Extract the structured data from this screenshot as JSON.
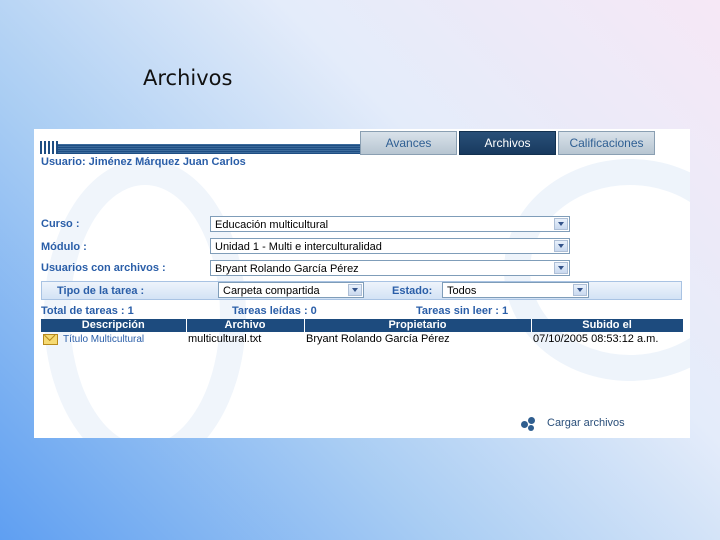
{
  "slide": {
    "title": "Archivos"
  },
  "tabs": [
    {
      "label": "Avances",
      "active": false
    },
    {
      "label": "Archivos",
      "active": true
    },
    {
      "label": "Calificaciones",
      "active": false
    }
  ],
  "user_line": "Usuario: Jiménez Márquez Juan Carlos",
  "filters": {
    "curso": {
      "label": "Curso :",
      "value": "Educación multicultural"
    },
    "modulo": {
      "label": "Módulo :",
      "value": "Unidad 1 - Multi e interculturalidad"
    },
    "usuarios": {
      "label": "Usuarios con archivos :",
      "value": "Bryant Rolando García Pérez"
    },
    "tipo": {
      "label": "Tipo de la tarea :",
      "value": "Carpeta compartida"
    },
    "estado": {
      "label": "Estado:",
      "value": "Todos"
    }
  },
  "counts": {
    "total": "Total de tareas : 1",
    "leidas": "Tareas leídas : 0",
    "sin_leer": "Tareas sin leer : 1"
  },
  "table": {
    "headers": [
      "Descripción",
      "Archivo",
      "Propietario",
      "Subido el"
    ],
    "rows": [
      {
        "descripcion": "Título Multicultural",
        "archivo": "multicultural.txt",
        "propietario": "Bryant Rolando García Pérez",
        "subido": "07/10/2005 08:53:12 a.m."
      }
    ]
  },
  "upload_label": "Cargar archivos",
  "icons": [
    "envelope-icon",
    "upload-icon",
    "dropdown-arrow-icon"
  ],
  "colors": {
    "label_blue": "#2a5ea8",
    "header_navy": "#1d4b7e",
    "active_tab": "#183a5f"
  }
}
